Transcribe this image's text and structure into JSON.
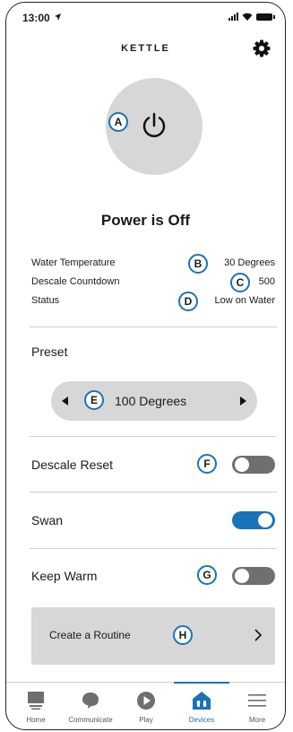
{
  "status_bar": {
    "time": "13:00"
  },
  "header": {
    "title": "KETTLE"
  },
  "power_status": "Power is Off",
  "info": [
    {
      "label": "Water Temperature",
      "value": "30 Degrees"
    },
    {
      "label": "Descale Countdown",
      "value": "500"
    },
    {
      "label": "Status",
      "value": "Low on Water"
    }
  ],
  "preset": {
    "label": "Preset",
    "value": "100 Degrees"
  },
  "controls": {
    "descale_reset": {
      "label": "Descale Reset",
      "on": false
    },
    "swan": {
      "label": "Swan",
      "on": true
    },
    "keep_warm": {
      "label": "Keep Warm",
      "on": false
    }
  },
  "routine": {
    "label": "Create a Routine"
  },
  "markers": [
    "A",
    "B",
    "C",
    "D",
    "E",
    "F",
    "G",
    "H"
  ],
  "tabs": [
    {
      "label": "Home",
      "icon": "home-icon"
    },
    {
      "label": "Communicate",
      "icon": "chat-icon"
    },
    {
      "label": "Play",
      "icon": "play-icon"
    },
    {
      "label": "Devices",
      "icon": "devices-icon",
      "active": true
    },
    {
      "label": "More",
      "icon": "menu-icon"
    }
  ],
  "colors": {
    "accent": "#1a73b8",
    "panel": "#d7d7d7",
    "toggle_off": "#6f6f6f"
  }
}
